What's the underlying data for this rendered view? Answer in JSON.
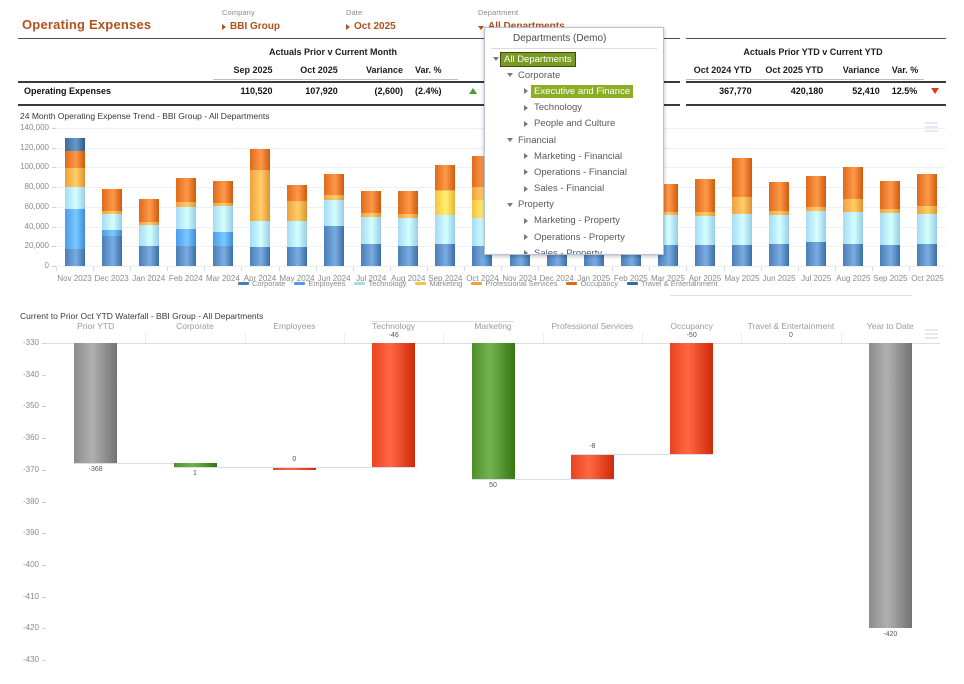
{
  "header": {
    "title": "Operating Expenses",
    "filters": [
      {
        "label": "Company",
        "value": "BBI Group",
        "icon": "triangle-right",
        "name": "company"
      },
      {
        "label": "Date",
        "value": "Oct 2025",
        "icon": "triangle-right",
        "name": "date"
      },
      {
        "label": "Department",
        "value": "All Departments",
        "icon": "triangle-down",
        "name": "department"
      }
    ]
  },
  "dropdown": {
    "heading": "Departments (Demo)",
    "items": [
      {
        "label": "All Departments",
        "level": 0,
        "expander": "caret-down",
        "state": "selected-outline"
      },
      {
        "label": "Corporate",
        "level": 1,
        "expander": "caret-down",
        "state": "normal"
      },
      {
        "label": "Executive and Finance",
        "level": 2,
        "expander": "caret-right",
        "state": "selected-fill"
      },
      {
        "label": "Technology",
        "level": 2,
        "expander": "caret-right",
        "state": "normal"
      },
      {
        "label": "People and Culture",
        "level": 2,
        "expander": "caret-right",
        "state": "normal"
      },
      {
        "label": "Financial",
        "level": 1,
        "expander": "caret-down",
        "state": "normal"
      },
      {
        "label": "Marketing - Financial",
        "level": 2,
        "expander": "caret-right",
        "state": "normal"
      },
      {
        "label": "Operations - Financial",
        "level": 2,
        "expander": "caret-right",
        "state": "normal"
      },
      {
        "label": "Sales - Financial",
        "level": 2,
        "expander": "caret-right",
        "state": "normal"
      },
      {
        "label": "Property",
        "level": 1,
        "expander": "caret-down",
        "state": "normal"
      },
      {
        "label": "Marketing - Property",
        "level": 2,
        "expander": "caret-right",
        "state": "normal"
      },
      {
        "label": "Operations - Property",
        "level": 2,
        "expander": "caret-right",
        "state": "normal"
      },
      {
        "label": "Sales - Property",
        "level": 2,
        "expander": "caret-right",
        "state": "normal"
      }
    ]
  },
  "table_month": {
    "group_header": "Actuals Prior v Current Month",
    "columns": [
      "Sep 2025",
      "Oct 2025",
      "Variance",
      "Var. %"
    ],
    "row_label": "Operating Expenses",
    "values": [
      "110,520",
      "107,920",
      "(2,600)",
      "(2.4%)"
    ],
    "indicator": "up-triangle-green"
  },
  "table_ytd": {
    "group_header": "Actuals Prior YTD v Current YTD",
    "columns": [
      "Oct 2024 YTD",
      "Oct 2025 YTD",
      "Variance",
      "Var. %"
    ],
    "values": [
      "367,770",
      "420,180",
      "52,410",
      "12.5%"
    ],
    "indicator": "down-triangle-red"
  },
  "chart_data": [
    {
      "type": "bar",
      "stacked": true,
      "name": "trend",
      "title": "24 Month Operating Expense Trend - BBI Group - All Departments",
      "xlabel": "",
      "ylabel": "",
      "ylim": [
        0,
        140000
      ],
      "yticks": [
        "0",
        "20,000",
        "40,000",
        "60,000",
        "80,000",
        "100,000",
        "120,000",
        "140,000"
      ],
      "grid": true,
      "legend_position": "bottom",
      "categories": [
        "Nov 2023",
        "Dec 2023",
        "Jan 2024",
        "Feb 2024",
        "Mar 2024",
        "Apr 2024",
        "May 2024",
        "Jun 2024",
        "Jul 2024",
        "Aug 2024",
        "Sep 2024",
        "Oct 2024",
        "Nov 2024",
        "Dec 2024",
        "Jan 2025",
        "Feb 2025",
        "Mar 2025",
        "Apr 2025",
        "May 2025",
        "Jun 2025",
        "Jul 2025",
        "Aug 2025",
        "Sep 2025",
        "Oct 2025"
      ],
      "series": [
        {
          "name": "Corporate",
          "color": "#4A7EB5",
          "values": [
            17000,
            30000,
            20000,
            20000,
            20000,
            19500,
            19500,
            41000,
            22500,
            20000,
            22000,
            20500,
            21000,
            22000,
            21500,
            22000,
            21500,
            21000,
            21500,
            22000,
            24000,
            22000,
            21500,
            22000
          ]
        },
        {
          "name": "Employees",
          "color": "#4D9BE8",
          "values": [
            41000,
            7000,
            0,
            18000,
            15000,
            0,
            0,
            0,
            0,
            0,
            0,
            0,
            0,
            0,
            0,
            0,
            0,
            0,
            0,
            0,
            0,
            0,
            0,
            0
          ]
        },
        {
          "name": "Technology",
          "color": "#A6DBF5",
          "values": [
            22000,
            16000,
            22000,
            22000,
            26000,
            26000,
            26000,
            26000,
            27000,
            29000,
            30000,
            28000,
            30000,
            30000,
            30000,
            30000,
            30000,
            30000,
            31000,
            30000,
            32000,
            33000,
            32000,
            31000
          ]
        },
        {
          "name": "Marketing",
          "color": "#F7C242",
          "values": [
            0,
            0,
            0,
            0,
            0,
            0,
            0,
            0,
            0,
            0,
            24000,
            18000,
            0,
            0,
            0,
            0,
            0,
            0,
            0,
            0,
            0,
            0,
            0,
            0
          ]
        },
        {
          "name": "Professional Services",
          "color": "#F0A03C",
          "values": [
            19000,
            3000,
            3000,
            5000,
            3000,
            52000,
            20000,
            5000,
            4000,
            4000,
            1000,
            14000,
            3000,
            3000,
            3000,
            3000,
            3000,
            4000,
            18000,
            4000,
            4000,
            13000,
            4000,
            8000
          ]
        },
        {
          "name": "Occupancy",
          "color": "#DE6A1B",
          "values": [
            18000,
            22000,
            23000,
            24000,
            22000,
            21500,
            17000,
            21000,
            22500,
            23000,
            25000,
            31000,
            23000,
            30000,
            28000,
            30000,
            29000,
            33000,
            39000,
            29000,
            31000,
            32000,
            29000,
            32000
          ]
        },
        {
          "name": "Travel & Entertainment",
          "color": "#3A6A9B",
          "values": [
            13000,
            0,
            0,
            0,
            0,
            0,
            0,
            0,
            0,
            0,
            0,
            0,
            0,
            0,
            0,
            0,
            0,
            0,
            0,
            0,
            0,
            0,
            0,
            0
          ]
        }
      ]
    },
    {
      "type": "bar",
      "waterfall": true,
      "name": "waterfall",
      "title": "Current to Prior Oct YTD Waterfall - BBI Group - All Departments",
      "ylim": [
        -430,
        -330
      ],
      "yticks": [
        "-330",
        "-340",
        "-350",
        "-360",
        "-370",
        "-380",
        "-390",
        "-400",
        "-410",
        "-420",
        "-430"
      ],
      "grid": false,
      "categories": [
        "Prior YTD",
        "Corporate",
        "Employees",
        "Technology",
        "Marketing",
        "Professional Services",
        "Occupancy",
        "Travel & Entertainment",
        "Year to Date"
      ],
      "values": [
        -368,
        1,
        0,
        -46,
        50,
        -8,
        -50,
        0,
        -420
      ],
      "labels": [
        "-368",
        "1",
        "0",
        "-46",
        "50",
        "-8",
        "-50",
        "0",
        "-420"
      ],
      "bar_kinds": [
        "total",
        "increase",
        "neutral",
        "decrease",
        "increase",
        "decrease",
        "decrease",
        "neutral",
        "total"
      ],
      "colors": {
        "total": "#8C8C8C",
        "increase": "#4E8F2C",
        "decrease": "#E8431F",
        "neutral": "#E8431F"
      }
    }
  ]
}
